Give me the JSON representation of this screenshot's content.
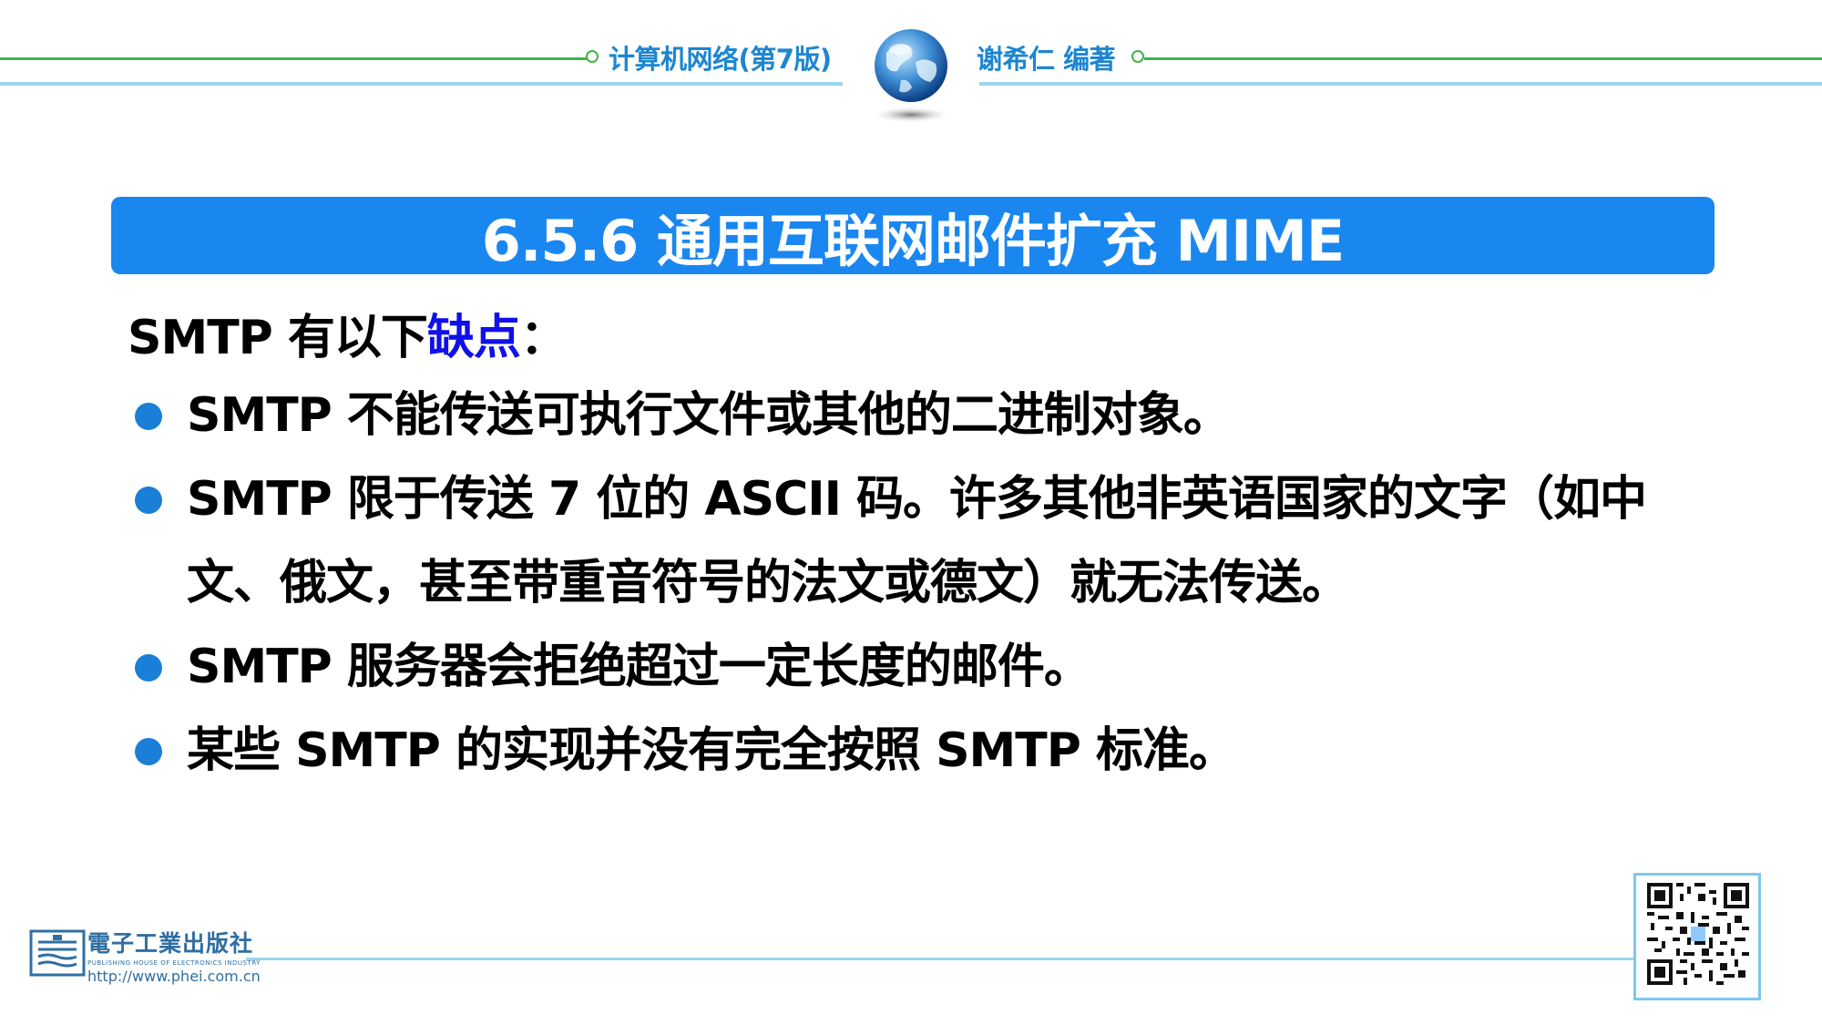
{
  "header": {
    "book_title": "计算机网络(第7版)",
    "author": "谢希仁 编著",
    "globe_icon": "globe-icon",
    "colors": {
      "green_line": "#3cb64a",
      "blue_line": "#9cd3ee",
      "text": "#1d86d0"
    }
  },
  "slide": {
    "title": "6.5.6  通用互联网邮件扩充 MIME",
    "title_bg": "#1a87f0",
    "intro": {
      "prefix": "SMTP 有以下",
      "highlight": "缺点",
      "suffix": "：",
      "highlight_color": "#1010e8"
    },
    "bullets": [
      {
        "text": "SMTP 不能传送可执行文件或其他的二进制对象。"
      },
      {
        "text": "SMTP 限于传送 7 位的 ASCII 码。许多其他非英语国家的文字（如中文、俄文，甚至带重音符号的法文或德文）就无法传送。"
      },
      {
        "text": "SMTP 服务器会拒绝超过一定长度的邮件。"
      },
      {
        "text": "某些 SMTP 的实现并没有完全按照 SMTP 标准。"
      }
    ],
    "bullet_color": "#1a7fd6"
  },
  "footer": {
    "publisher_name": "電子工業出版社",
    "publisher_en": "PUBLISHING HOUSE OF ELECTRONICS INDUSTRY",
    "publisher_url": "http://www.phei.com.cn",
    "qr_icon": "qr-code-icon"
  }
}
